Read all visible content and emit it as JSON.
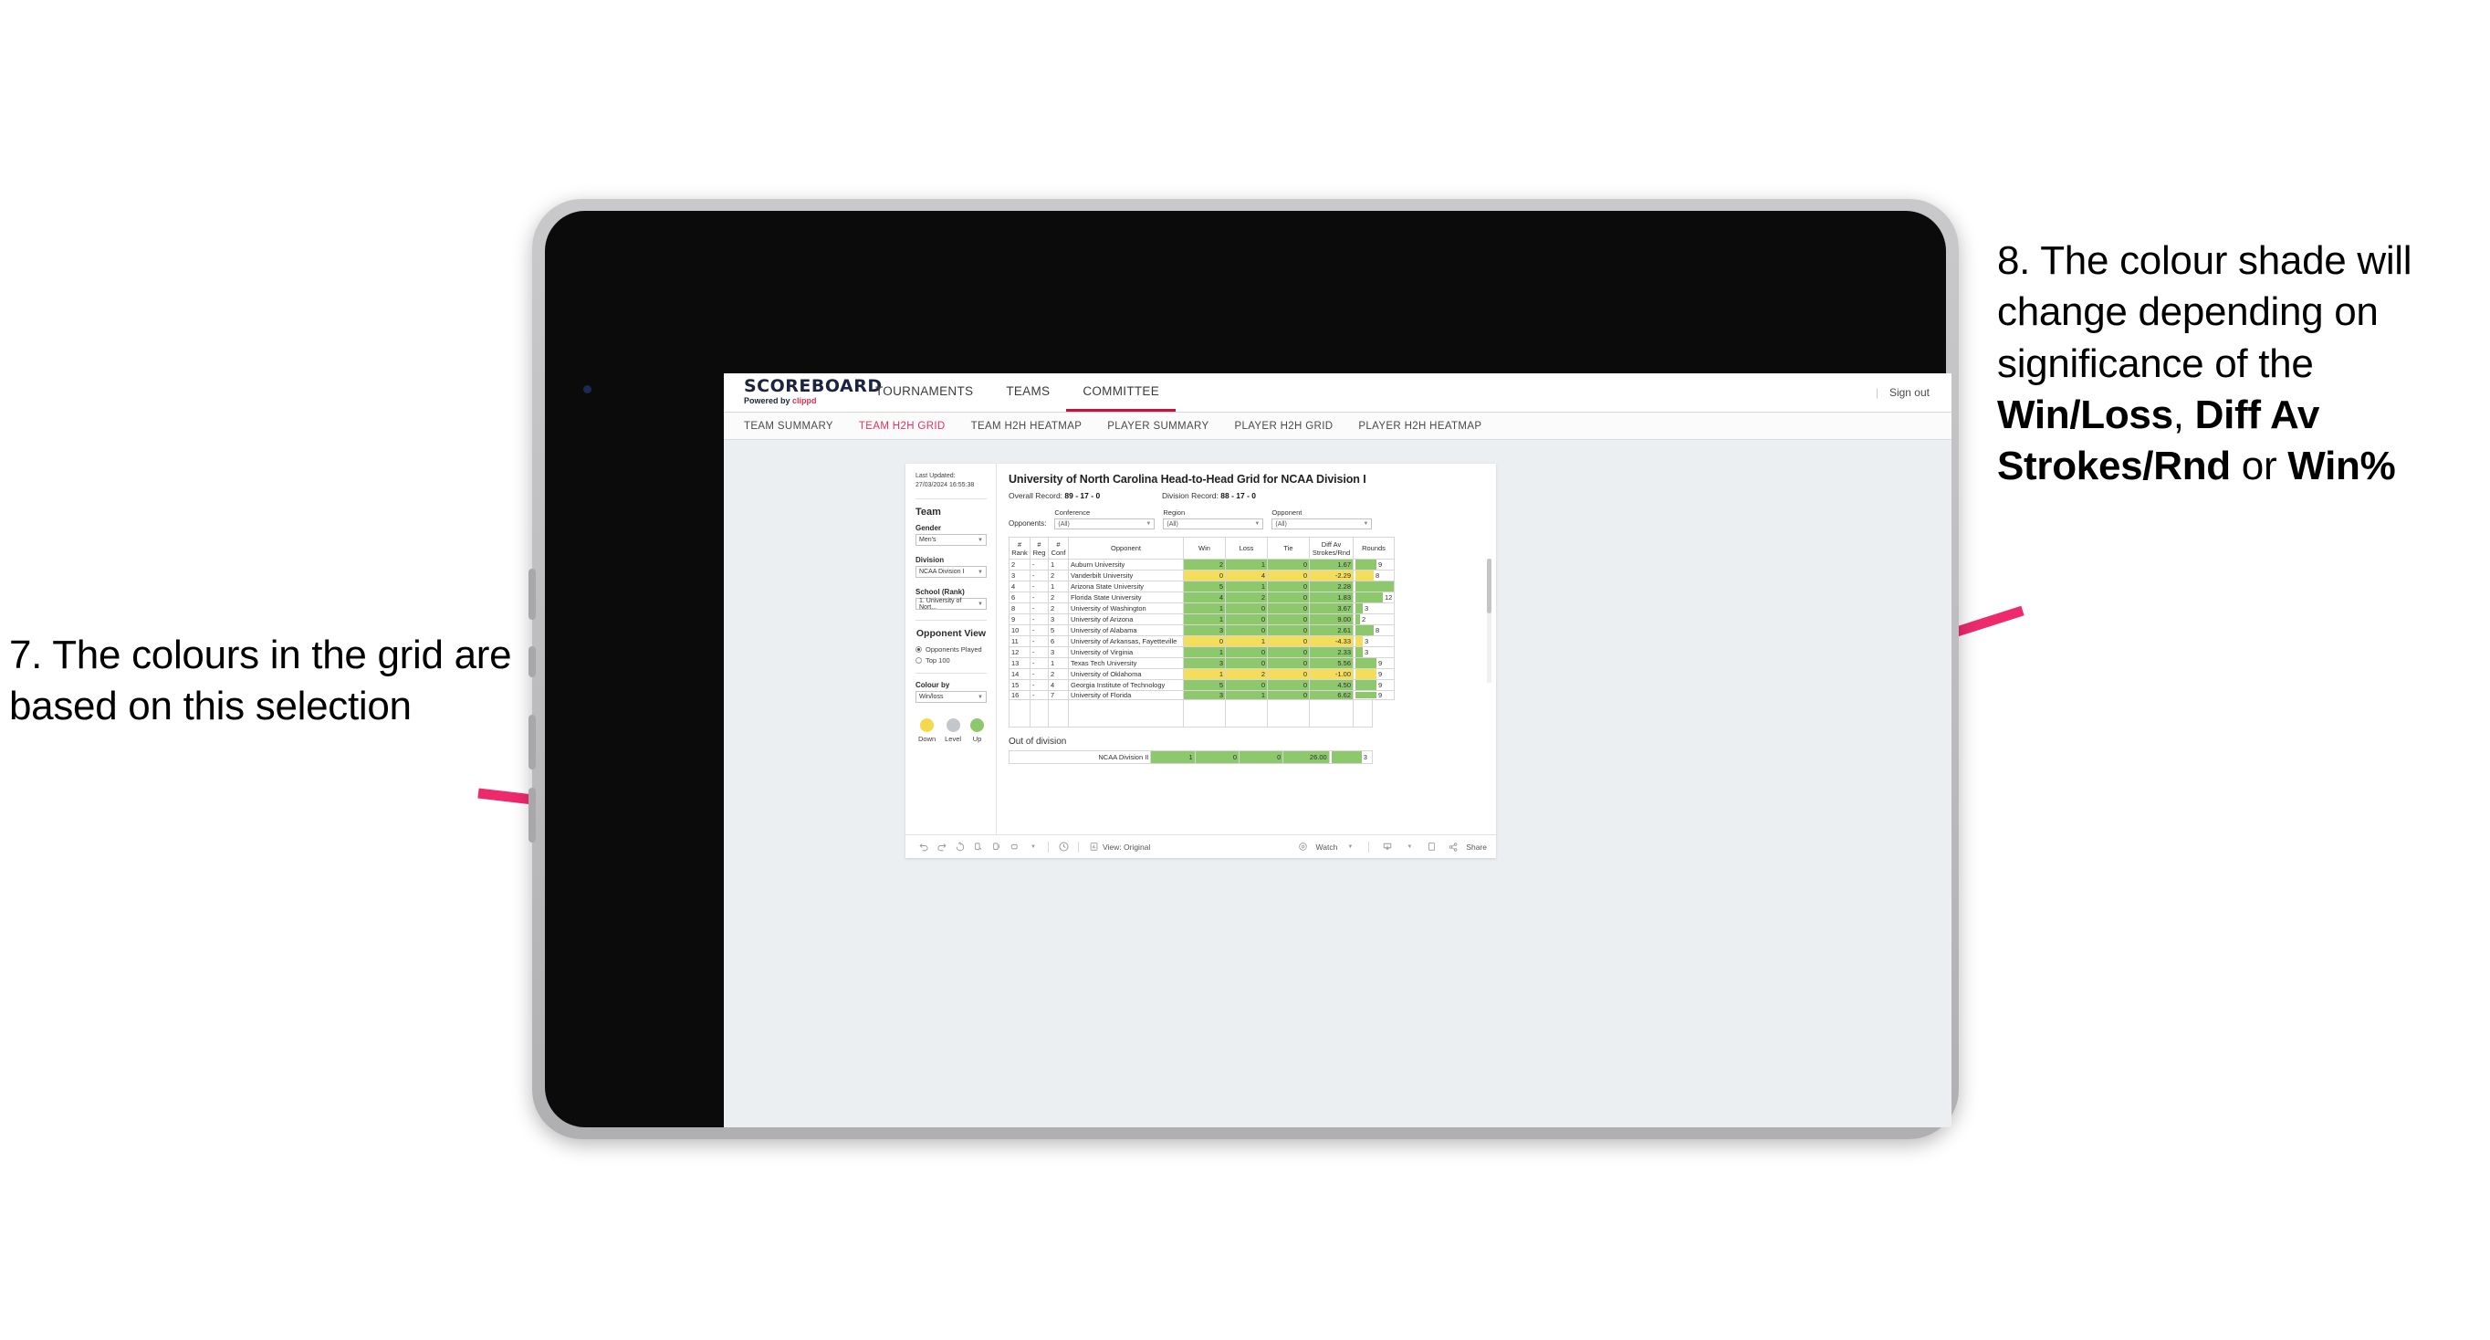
{
  "annotations": {
    "left": {
      "number": "7.",
      "text": "7. The colours in the grid are based on this selection"
    },
    "right": {
      "part1": "8. The colour shade will change depending on significance of the ",
      "bold1": "Win/Loss",
      "mid1": ", ",
      "bold2": "Diff Av Strokes/Rnd",
      "mid2": " or ",
      "bold3": "Win%"
    },
    "arrow_color": "#ee2a6c"
  },
  "app": {
    "logo": {
      "title": "SCOREBOARD",
      "powered_prefix": "Powered by ",
      "brand": "clippd"
    },
    "topnav": [
      {
        "label": "TOURNAMENTS",
        "active": false
      },
      {
        "label": "TEAMS",
        "active": false
      },
      {
        "label": "COMMITTEE",
        "active": true
      }
    ],
    "signout": {
      "divider": "|",
      "label": "Sign out"
    },
    "subnav": [
      {
        "label": "TEAM SUMMARY",
        "active": false
      },
      {
        "label": "TEAM H2H GRID",
        "active": true
      },
      {
        "label": "TEAM H2H HEATMAP",
        "active": false
      },
      {
        "label": "PLAYER SUMMARY",
        "active": false
      },
      {
        "label": "PLAYER H2H GRID",
        "active": false
      },
      {
        "label": "PLAYER H2H HEATMAP",
        "active": false
      }
    ]
  },
  "sidebar": {
    "last_updated": "Last Updated: 27/03/2024 16:55:38",
    "team_heading": "Team",
    "gender": {
      "label": "Gender",
      "value": "Men's"
    },
    "division": {
      "label": "Division",
      "value": "NCAA Division I"
    },
    "school": {
      "label": "School (Rank)",
      "value": "1. University of Nort..."
    },
    "opponent_view": {
      "heading": "Opponent View",
      "options": [
        {
          "label": "Opponents Played",
          "selected": true
        },
        {
          "label": "Top 100",
          "selected": false
        }
      ]
    },
    "colour_by": {
      "label": "Colour by",
      "value": "Win/loss"
    },
    "legend": [
      {
        "caption": "Down",
        "color": "#f5d94d"
      },
      {
        "caption": "Level",
        "color": "#c3c6cb"
      },
      {
        "caption": "Up",
        "color": "#8dc96c"
      }
    ]
  },
  "main": {
    "title": "University of North Carolina Head-to-Head Grid for NCAA Division I",
    "overall_record": {
      "label": "Overall Record: ",
      "value": "89 - 17 - 0"
    },
    "division_record": {
      "label": "Division Record: ",
      "value": "88 - 17 - 0"
    },
    "opponents_label": "Opponents:",
    "filters": [
      {
        "label": "Conference",
        "value": "(All)"
      },
      {
        "label": "Region",
        "value": "(All)"
      },
      {
        "label": "Opponent",
        "value": "(All)"
      }
    ],
    "columns": [
      {
        "line1": "#",
        "line2": "Rank"
      },
      {
        "line1": "#",
        "line2": "Reg"
      },
      {
        "line1": "#",
        "line2": "Conf"
      },
      {
        "line1": "",
        "line2": "Opponent"
      },
      {
        "line1": "",
        "line2": "Win"
      },
      {
        "line1": "",
        "line2": "Loss"
      },
      {
        "line1": "",
        "line2": "Tie"
      },
      {
        "line1": "Diff Av",
        "line2": "Strokes/Rnd"
      },
      {
        "line1": "",
        "line2": "Rounds"
      }
    ],
    "rows": [
      {
        "rank": "2",
        "reg": "-",
        "conf": "1",
        "opponent": "Auburn University",
        "win": "2",
        "loss": "1",
        "tie": "0",
        "diff": "1.67",
        "rounds": "9",
        "state": "win"
      },
      {
        "rank": "3",
        "reg": "-",
        "conf": "2",
        "opponent": "Vanderbilt University",
        "win": "0",
        "loss": "4",
        "tie": "0",
        "diff": "-2.29",
        "rounds": "8",
        "state": "loss"
      },
      {
        "rank": "4",
        "reg": "-",
        "conf": "1",
        "opponent": "Arizona State University",
        "win": "5",
        "loss": "1",
        "tie": "0",
        "diff": "2.28",
        "rounds": "17",
        "state": "win"
      },
      {
        "rank": "6",
        "reg": "-",
        "conf": "2",
        "opponent": "Florida State University",
        "win": "4",
        "loss": "2",
        "tie": "0",
        "diff": "1.83",
        "rounds": "12",
        "state": "win"
      },
      {
        "rank": "8",
        "reg": "-",
        "conf": "2",
        "opponent": "University of Washington",
        "win": "1",
        "loss": "0",
        "tie": "0",
        "diff": "3.67",
        "rounds": "3",
        "state": "win"
      },
      {
        "rank": "9",
        "reg": "-",
        "conf": "3",
        "opponent": "University of Arizona",
        "win": "1",
        "loss": "0",
        "tie": "0",
        "diff": "9.00",
        "rounds": "2",
        "state": "win"
      },
      {
        "rank": "10",
        "reg": "-",
        "conf": "5",
        "opponent": "University of Alabama",
        "win": "3",
        "loss": "0",
        "tie": "0",
        "diff": "2.61",
        "rounds": "8",
        "state": "win"
      },
      {
        "rank": "11",
        "reg": "-",
        "conf": "6",
        "opponent": "University of Arkansas, Fayetteville",
        "win": "0",
        "loss": "1",
        "tie": "0",
        "diff": "-4.33",
        "rounds": "3",
        "state": "loss"
      },
      {
        "rank": "12",
        "reg": "-",
        "conf": "3",
        "opponent": "University of Virginia",
        "win": "1",
        "loss": "0",
        "tie": "0",
        "diff": "2.33",
        "rounds": "3",
        "state": "win"
      },
      {
        "rank": "13",
        "reg": "-",
        "conf": "1",
        "opponent": "Texas Tech University",
        "win": "3",
        "loss": "0",
        "tie": "0",
        "diff": "5.56",
        "rounds": "9",
        "state": "win"
      },
      {
        "rank": "14",
        "reg": "-",
        "conf": "2",
        "opponent": "University of Oklahoma",
        "win": "1",
        "loss": "2",
        "tie": "0",
        "diff": "-1.00",
        "rounds": "9",
        "state": "loss"
      },
      {
        "rank": "15",
        "reg": "-",
        "conf": "4",
        "opponent": "Georgia Institute of Technology",
        "win": "5",
        "loss": "0",
        "tie": "0",
        "diff": "4.50",
        "rounds": "9",
        "state": "win"
      },
      {
        "rank": "16",
        "reg": "-",
        "conf": "7",
        "opponent": "University of Florida",
        "win": "3",
        "loss": "1",
        "tie": "0",
        "diff": "6.62",
        "rounds": "9",
        "state": "win"
      }
    ],
    "out_of_division": {
      "title": "Out of division",
      "row": {
        "name": "NCAA Division II",
        "win": "1",
        "loss": "0",
        "tie": "0",
        "diff": "26.00",
        "rounds": "3"
      }
    }
  },
  "toolbar": {
    "view_label": "View: Original",
    "watch_label": "Watch",
    "share_label": "Share",
    "icons": [
      "undo-icon",
      "redo-icon",
      "revert-icon",
      "refresh-icon",
      "pause-icon",
      "custom-view-icon",
      "caret-down-icon",
      "clock-icon"
    ]
  },
  "chart_data": {
    "type": "table",
    "title": "University of North Carolina Head-to-Head Grid for NCAA Division I",
    "columns": [
      "# Rank",
      "# Reg",
      "# Conf",
      "Opponent",
      "Win",
      "Loss",
      "Tie",
      "Diff Av Strokes/Rnd",
      "Rounds"
    ],
    "rounds_max": 17,
    "color_encoding": {
      "win": "#8dc96c",
      "loss": "#f5dd5c",
      "level": "#c3c6cb"
    },
    "colour_by": "Win/loss"
  }
}
